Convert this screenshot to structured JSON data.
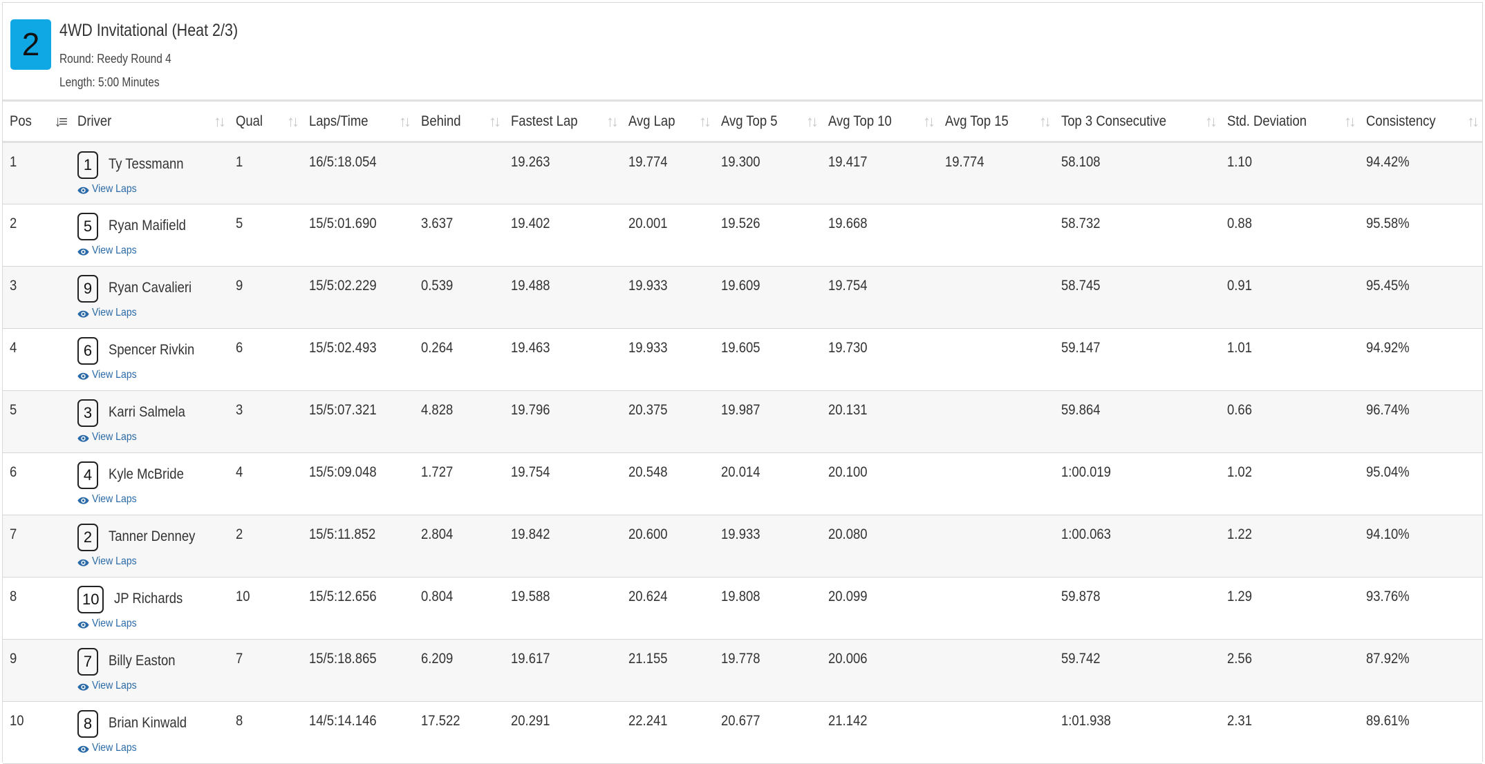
{
  "heat": {
    "number": "2",
    "title": "4WD Invitational (Heat 2/3)",
    "round": "Round: Reedy Round 4",
    "length": "Length: 5:00 Minutes",
    "badge_color": "#0fa7e4"
  },
  "table": {
    "view_laps_label": "View Laps",
    "columns": [
      "Pos",
      "Driver",
      "Qual",
      "Laps/Time",
      "Behind",
      "Fastest Lap",
      "Avg Lap",
      "Avg Top 5",
      "Avg Top 10",
      "Avg Top 15",
      "Top 3 Consecutive",
      "Std. Deviation",
      "Consistency"
    ],
    "sorted_column": "Pos",
    "rows": [
      {
        "pos": "1",
        "car": "1",
        "driver": "Ty Tessmann",
        "qual": "1",
        "laps": "16/5:18.054",
        "behind": "",
        "fastest": "19.263",
        "avg": "19.774",
        "top5": "19.300",
        "top10": "19.417",
        "top15": "19.774",
        "top3c": "58.108",
        "std": "1.10",
        "consistency": "94.42%"
      },
      {
        "pos": "2",
        "car": "5",
        "driver": "Ryan Maifield",
        "qual": "5",
        "laps": "15/5:01.690",
        "behind": "3.637",
        "fastest": "19.402",
        "avg": "20.001",
        "top5": "19.526",
        "top10": "19.668",
        "top15": "",
        "top3c": "58.732",
        "std": "0.88",
        "consistency": "95.58%"
      },
      {
        "pos": "3",
        "car": "9",
        "driver": "Ryan Cavalieri",
        "qual": "9",
        "laps": "15/5:02.229",
        "behind": "0.539",
        "fastest": "19.488",
        "avg": "19.933",
        "top5": "19.609",
        "top10": "19.754",
        "top15": "",
        "top3c": "58.745",
        "std": "0.91",
        "consistency": "95.45%"
      },
      {
        "pos": "4",
        "car": "6",
        "driver": "Spencer Rivkin",
        "qual": "6",
        "laps": "15/5:02.493",
        "behind": "0.264",
        "fastest": "19.463",
        "avg": "19.933",
        "top5": "19.605",
        "top10": "19.730",
        "top15": "",
        "top3c": "59.147",
        "std": "1.01",
        "consistency": "94.92%"
      },
      {
        "pos": "5",
        "car": "3",
        "driver": "Karri Salmela",
        "qual": "3",
        "laps": "15/5:07.321",
        "behind": "4.828",
        "fastest": "19.796",
        "avg": "20.375",
        "top5": "19.987",
        "top10": "20.131",
        "top15": "",
        "top3c": "59.864",
        "std": "0.66",
        "consistency": "96.74%"
      },
      {
        "pos": "6",
        "car": "4",
        "driver": "Kyle McBride",
        "qual": "4",
        "laps": "15/5:09.048",
        "behind": "1.727",
        "fastest": "19.754",
        "avg": "20.548",
        "top5": "20.014",
        "top10": "20.100",
        "top15": "",
        "top3c": "1:00.019",
        "std": "1.02",
        "consistency": "95.04%"
      },
      {
        "pos": "7",
        "car": "2",
        "driver": "Tanner Denney",
        "qual": "2",
        "laps": "15/5:11.852",
        "behind": "2.804",
        "fastest": "19.842",
        "avg": "20.600",
        "top5": "19.933",
        "top10": "20.080",
        "top15": "",
        "top3c": "1:00.063",
        "std": "1.22",
        "consistency": "94.10%"
      },
      {
        "pos": "8",
        "car": "10",
        "driver": "JP Richards",
        "qual": "10",
        "laps": "15/5:12.656",
        "behind": "0.804",
        "fastest": "19.588",
        "avg": "20.624",
        "top5": "19.808",
        "top10": "20.099",
        "top15": "",
        "top3c": "59.878",
        "std": "1.29",
        "consistency": "93.76%"
      },
      {
        "pos": "9",
        "car": "7",
        "driver": "Billy Easton",
        "qual": "7",
        "laps": "15/5:18.865",
        "behind": "6.209",
        "fastest": "19.617",
        "avg": "21.155",
        "top5": "19.778",
        "top10": "20.006",
        "top15": "",
        "top3c": "59.742",
        "std": "2.56",
        "consistency": "87.92%"
      },
      {
        "pos": "10",
        "car": "8",
        "driver": "Brian Kinwald",
        "qual": "8",
        "laps": "14/5:14.146",
        "behind": "17.522",
        "fastest": "20.291",
        "avg": "22.241",
        "top5": "20.677",
        "top10": "21.142",
        "top15": "",
        "top3c": "1:01.938",
        "std": "2.31",
        "consistency": "89.61%"
      }
    ]
  }
}
